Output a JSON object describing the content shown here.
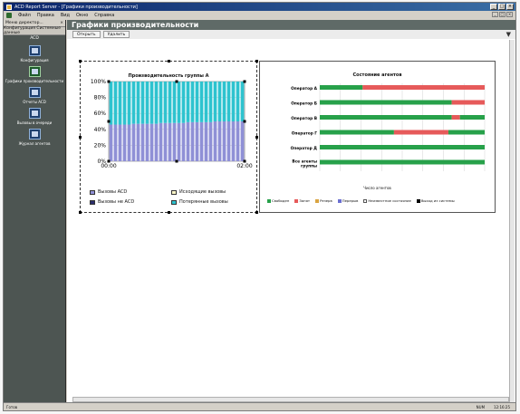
{
  "window": {
    "title": "ACD Report Server - [Графики производительности]"
  },
  "menu": [
    "Файл",
    "Правка",
    "Вид",
    "Окно",
    "Справка"
  ],
  "sidebar": {
    "header": "Меню директор...",
    "section": "Конфигурация Системные данные",
    "group": "ACD",
    "items": [
      {
        "label": "Конфигурация",
        "icon": "config-icon"
      },
      {
        "label": "Графики производительности",
        "icon": "chart-icon"
      },
      {
        "label": "Отчеты ACD",
        "icon": "report-icon"
      },
      {
        "label": "Вызовы в очереди",
        "icon": "queue-icon"
      },
      {
        "label": "Журнал агентов",
        "icon": "log-icon"
      }
    ]
  },
  "main": {
    "title": "Графики производительности",
    "toolbar": {
      "open": "Открыть",
      "remove": "Удалить"
    }
  },
  "chart_a": {
    "chart_data": {
      "type": "bar",
      "title": "Производительность группы А",
      "ylim": [
        0,
        100
      ],
      "y_ticks": [
        "0%",
        "20%",
        "40%",
        "60%",
        "80%",
        "100%"
      ],
      "x_ticks": [
        "00:00",
        "02:00"
      ],
      "series": [
        {
          "name": "Вызовы ACD",
          "color": "#8f90d6",
          "values": [
            46,
            46,
            46,
            46,
            46,
            47,
            47,
            47,
            47,
            47,
            47,
            48,
            48,
            48,
            48,
            48,
            48,
            49,
            49,
            49,
            49,
            49,
            49,
            50,
            50,
            50,
            50,
            50,
            50,
            50
          ]
        },
        {
          "name": "Потерянные вызовы",
          "color": "#2ec3cf",
          "values": [
            54,
            54,
            54,
            54,
            54,
            53,
            53,
            53,
            53,
            53,
            53,
            52,
            52,
            52,
            52,
            52,
            52,
            51,
            51,
            51,
            51,
            51,
            51,
            50,
            50,
            50,
            50,
            50,
            50,
            50
          ]
        }
      ],
      "legend": [
        {
          "name": "Вызовы ACD",
          "color": "#8f90d6"
        },
        {
          "name": "Исходящие вызовы",
          "color": "#fbf6c8"
        },
        {
          "name": "Вызовы не ACD",
          "color": "#2c2f6e"
        },
        {
          "name": "Потерянные вызовы",
          "color": "#2ec3cf"
        }
      ]
    }
  },
  "chart_b": {
    "chart_data": {
      "type": "bar",
      "title": "Состояние агентов",
      "xlabel": "Число агентов",
      "categories": [
        "Оператор А",
        "Оператор Б",
        "Оператор В",
        "Оператор Г",
        "Оператор Д",
        "Все агенты группы"
      ],
      "series": [
        {
          "name": "Свободен",
          "color": "#27a14a"
        },
        {
          "name": "Занят",
          "color": "#e65a5a"
        },
        {
          "name": "Резерв",
          "color": "#d9a441"
        },
        {
          "name": "Перерыв",
          "color": "#6a6fd1"
        },
        {
          "name": "Неизвестное состояние",
          "color": "#ffffff"
        },
        {
          "name": "Выход из системы",
          "color": "#000000"
        }
      ],
      "segments": [
        [
          [
            0,
            0.26,
            "#27a14a"
          ],
          [
            0.26,
            1,
            "#e65a5a"
          ]
        ],
        [
          [
            0,
            0.8,
            "#27a14a"
          ],
          [
            0.8,
            1,
            "#e65a5a"
          ]
        ],
        [
          [
            0,
            0.8,
            "#27a14a"
          ],
          [
            0.8,
            0.85,
            "#e65a5a"
          ],
          [
            0.85,
            1,
            "#27a14a"
          ]
        ],
        [
          [
            0,
            0.45,
            "#27a14a"
          ],
          [
            0.45,
            0.78,
            "#e65a5a"
          ],
          [
            0.78,
            1,
            "#27a14a"
          ]
        ],
        [
          [
            0,
            1,
            "#27a14a"
          ]
        ],
        [
          [
            0,
            1,
            "#27a14a"
          ]
        ]
      ]
    }
  },
  "status": {
    "left": "Готов",
    "right1": "NUM",
    "right2": "12:16:25"
  }
}
